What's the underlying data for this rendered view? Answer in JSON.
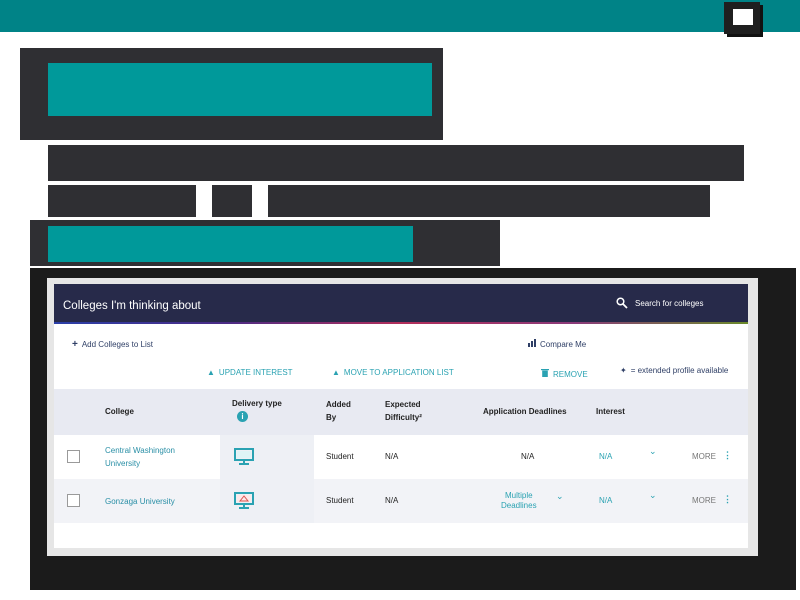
{
  "panel": {
    "title": "Colleges I'm thinking about",
    "search_label": "Search for colleges"
  },
  "actions": {
    "add": "Add Colleges to List",
    "compare": "Compare Me",
    "update_interest": "UPDATE INTEREST",
    "move_to_application": "MOVE TO APPLICATION LIST",
    "remove": "REMOVE",
    "extended_profile_note": "= extended profile available"
  },
  "table": {
    "headers": {
      "college": "College",
      "delivery_type": "Delivery type",
      "added_by_1": "Added",
      "added_by_2": "By",
      "expected_1": "Expected",
      "expected_2": "Difficulty²",
      "deadlines": "Application Deadlines",
      "interest": "Interest"
    },
    "rows": [
      {
        "college_1": "Central Washington",
        "college_2": "University",
        "added_by": "Student",
        "difficulty": "N/A",
        "deadlines": "N/A",
        "interest": "N/A",
        "more": "MORE"
      },
      {
        "college_1": "Gonzaga University",
        "added_by": "Student",
        "difficulty": "N/A",
        "deadlines_1": "Multiple",
        "deadlines_2": "Deadlines",
        "interest": "N/A",
        "more": "MORE"
      }
    ]
  },
  "colors": {
    "teal_topbar": "#008387",
    "header_navy": "#272a4a",
    "link_teal": "#2aa2b2",
    "redaction_dark": "#2f2f33"
  }
}
